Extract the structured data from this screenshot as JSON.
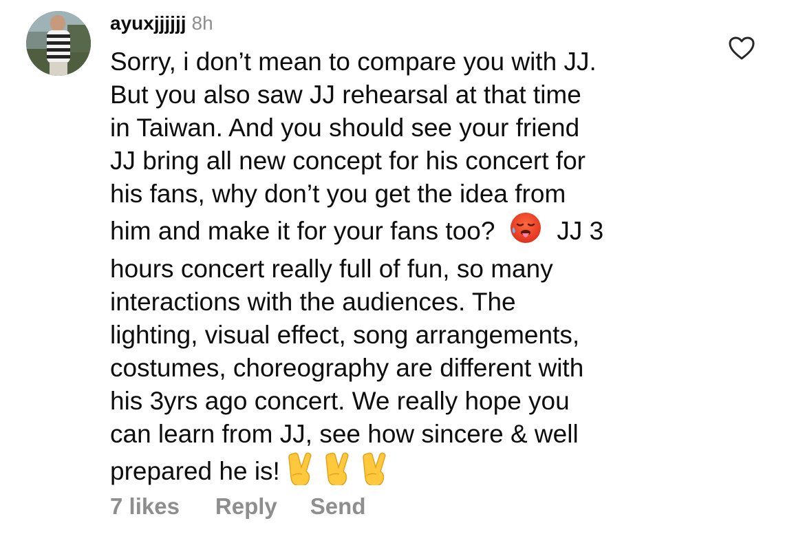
{
  "comment": {
    "username": "ayuxjjjjjj",
    "time": "8h",
    "lines": [
      "Sorry, i don’t mean to compare you with JJ.",
      "But you also saw JJ rehearsal at that time",
      "in Taiwan. And you should see your friend",
      "JJ bring all new concept for his concert for",
      "his fans, why don’t you get the idea from",
      "him and make it for your fans too?",
      "JJ 3",
      "hours concert really full of fun, so many",
      "interactions with the audiences. The",
      "lighting, visual effect, song arrangements,",
      "costumes, choreography are different with",
      "his 3yrs ago concert. We really hope you",
      "can learn from JJ, see how sincere & well",
      "prepared he is!"
    ],
    "emojis": {
      "hot_face": "hot-face-emoji",
      "victory_hand": "victory-hand-emoji"
    }
  },
  "actions": {
    "likes": "7 likes",
    "reply": "Reply",
    "send": "Send"
  },
  "colors": {
    "text": "#0d0d0d",
    "secondary": "#8e8e8e"
  }
}
